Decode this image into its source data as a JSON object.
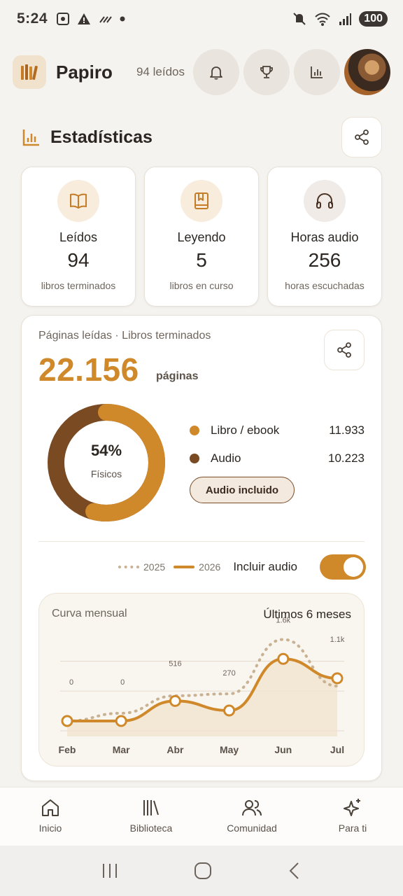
{
  "status_bar": {
    "time": "5:24",
    "battery": "100"
  },
  "header": {
    "app_name": "Papiro",
    "read_count": "94 leídos"
  },
  "section": {
    "title": "Estadísticas"
  },
  "stats": [
    {
      "label": "Leídos",
      "value": "94",
      "sub": "libros terminados",
      "icon": "book-open-icon"
    },
    {
      "label": "Leyendo",
      "value": "5",
      "sub": "libros en curso",
      "icon": "bookmark-book-icon"
    },
    {
      "label": "Horas audio",
      "value": "256",
      "sub": "horas escuchadas",
      "icon": "headphones-icon"
    }
  ],
  "pages_card": {
    "caption": "Páginas leídas · Libros terminados",
    "total": "22.156",
    "unit": "páginas",
    "donut_percent": "54%",
    "donut_label": "Físicos",
    "physical_fraction": 0.54,
    "legend": [
      {
        "label": "Libro / ebook",
        "value": "11.933",
        "color": "#d0892a"
      },
      {
        "label": "Audio",
        "value": "10.223",
        "color": "#7a4a22"
      }
    ],
    "audio_chip": "Audio incluido",
    "legend_2025": "2025",
    "legend_2026": "2026",
    "toggle_label": "Incluir audio",
    "toggle_on": true
  },
  "chart_data": {
    "type": "line",
    "title": "Curva mensual",
    "range_label": "Últimos 6 meses",
    "categories": [
      "Feb",
      "Mar",
      "Abr",
      "May",
      "Jun",
      "Jul"
    ],
    "series": [
      {
        "name": "2026",
        "values": [
          0,
          0,
          516,
          270,
          1600,
          1100
        ],
        "labels": [
          "0",
          "0",
          "516",
          "270",
          "1.6k",
          "1.1k"
        ],
        "style": "solid",
        "color": "#d0892a"
      },
      {
        "name": "2025",
        "values": [
          0,
          200,
          650,
          700,
          2100,
          900
        ],
        "style": "dotted",
        "color": "#c9b294"
      }
    ]
  },
  "bottom_nav": [
    {
      "label": "Inicio",
      "icon": "home-icon"
    },
    {
      "label": "Biblioteca",
      "icon": "library-icon"
    },
    {
      "label": "Comunidad",
      "icon": "community-icon"
    },
    {
      "label": "Para ti",
      "icon": "sparkles-icon"
    }
  ]
}
